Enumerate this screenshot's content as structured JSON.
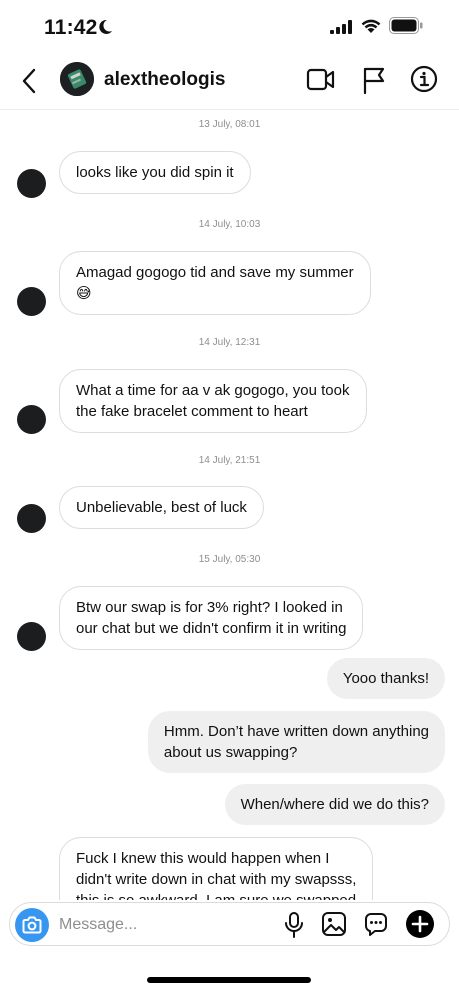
{
  "status": {
    "time": "11:42"
  },
  "header": {
    "username": "alextheologis"
  },
  "messages": [
    {
      "type": "timestamp",
      "text": "13 July, 08:01"
    },
    {
      "type": "incoming",
      "text": "looks like you did spin it"
    },
    {
      "type": "timestamp",
      "text": "14 July, 10:03"
    },
    {
      "type": "incoming",
      "text": "Amagad gogogo tid and save my summer\n😅"
    },
    {
      "type": "timestamp",
      "text": "14 July, 12:31"
    },
    {
      "type": "incoming",
      "text": "What a time for aa v ak gogogo, you took\nthe fake bracelet comment to heart"
    },
    {
      "type": "timestamp",
      "text": "14 July, 21:51"
    },
    {
      "type": "incoming",
      "text": "Unbelievable, best of luck"
    },
    {
      "type": "timestamp",
      "text": "15 July, 05:30"
    },
    {
      "type": "incoming",
      "text": "Btw our swap is for 3% right? I looked in\nour chat  but we didn't confirm it in writing"
    },
    {
      "type": "outgoing",
      "text": "Yooo thanks!"
    },
    {
      "type": "outgoing",
      "text": "Hmm. Don’t have written down anything\nabout us swapping?"
    },
    {
      "type": "outgoing",
      "text": "When/where did we do this?"
    },
    {
      "type": "incoming",
      "text": "Fuck I knew this would happen when I\ndidn't write down in chat with my swapsss,\nthis is so awkward. I am sure we swapped"
    }
  ],
  "composer": {
    "placeholder": "Message..."
  },
  "colors": {
    "accent": "#3797f0",
    "incoming_border": "#dcdcdc",
    "outgoing_bg": "#efefef"
  },
  "icons": [
    "back-icon",
    "video-call-icon",
    "flag-icon",
    "info-icon",
    "camera-icon",
    "microphone-icon",
    "gallery-icon",
    "sticker-icon",
    "plus-icon"
  ]
}
